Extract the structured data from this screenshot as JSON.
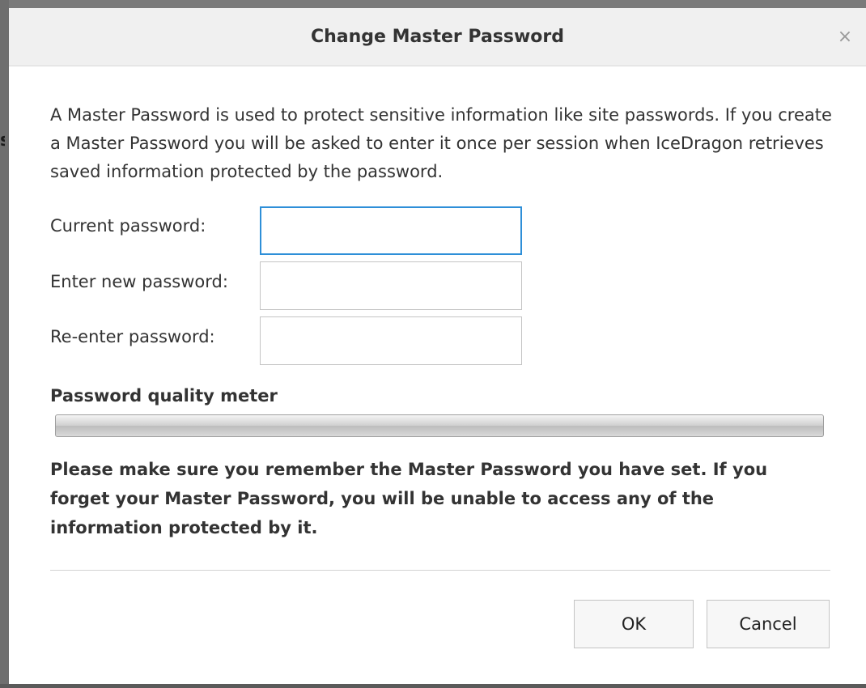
{
  "dialog": {
    "title": "Change Master Password",
    "close_glyph": "×",
    "close_icon": "close-icon",
    "description": "A Master Password is used to protect sensitive information like site passwords. If you create a Master Password you will be asked to enter it once per session when IceDragon retrieves saved information protected by the password.",
    "fields": {
      "current_label": "Current password:",
      "current_value": "",
      "new_label": "Enter new password:",
      "new_value": "",
      "reenter_label": "Re-enter password:",
      "reenter_value": ""
    },
    "meter": {
      "title": "Password quality meter",
      "level": 0
    },
    "warning": "Please make sure you remember the Master Password you have set. If you forget your Master Password, you will be unable to access any of the information protected by it.",
    "buttons": {
      "ok": "OK",
      "cancel": "Cancel"
    }
  },
  "background": {
    "left_glyph": "s"
  },
  "colors": {
    "focus_border": "#2e8fd8",
    "titlebar_bg": "#f0f0f0"
  }
}
